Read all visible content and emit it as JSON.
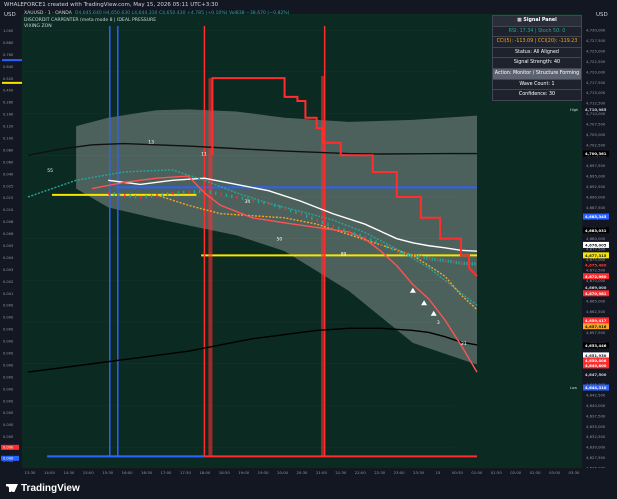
{
  "header": {
    "created_text": "WHALEFORCE1 created with TradingView.com, May 15, 2026 05:11 UTC+3:30",
    "symbol_line": "XAUUSD · 1 · OANDA",
    "ohlc": "O4,645.640 H4,650.630 L4,644.310 C4,650.430 +4.785 (+0.10%) Vol838 −38.670 (−0.82%)",
    "indicator_1": "DISCORDIT CARPENTER (meta mode 8 | IDEAL PRESSURE",
    "indicator_2": "VIXING ZON",
    "currency_left": "USD",
    "currency_right": "USD"
  },
  "signal_panel": {
    "title": "Signal Panel",
    "row_rsi": "RSI: 17.34 | Stoch 50: 0",
    "row_cci": "CCI(5): -113.09 | CCI(20): -119.23",
    "row_status": "Status: All Aligned",
    "row_strength": "Signal Strength: 40",
    "row_action": "Action: Monitor / Structure Forming",
    "row_wave": "Wave Count: 1",
    "row_confidence": "Confidence: 30",
    "colors": {
      "rsi_text": "#26a69a",
      "cci_text": "#f5a623",
      "action_bg": "#5d6270"
    }
  },
  "footer": {
    "brand": "TradingView"
  },
  "chart_data": {
    "type": "line",
    "x_ticks": [
      "13:30",
      "14:00",
      "14:30",
      "15:00",
      "15:30",
      "16:00",
      "16:30",
      "17:00",
      "17:30",
      "18:00",
      "18:30",
      "19:00",
      "19:30",
      "20:00",
      "20:30",
      "21:00",
      "21:30",
      "22:00",
      "22:30",
      "23:00",
      "23:30",
      "15",
      "00:30",
      "01:00",
      "01:30",
      "02:00",
      "02:30",
      "03:00",
      "03:30"
    ],
    "right_axis": {
      "ticks": [
        4730000,
        4727500,
        4725000,
        4722500,
        4720000,
        4717500,
        4715000,
        4712500,
        4710000,
        4707500,
        4705000,
        4702500,
        4700000,
        4697500,
        4695000,
        4692500,
        4690000,
        4687500,
        4685000,
        4682500,
        4680000,
        4677500,
        4675000,
        4672500,
        4670000,
        4667500,
        4665000,
        4662500,
        4660000,
        4657500,
        4655000,
        4652500,
        4650000,
        4647500,
        4645000,
        4642500,
        4640000,
        4637500,
        4635000,
        4632500,
        4630000,
        4627500,
        4625000
      ],
      "labels": [
        "4,730,000",
        "4,727,500",
        "4,725,000",
        "4,722,500",
        "4,720,000",
        "4,717,500",
        "4,715,000",
        "4,712,500",
        "4,710,000",
        "4,707,500",
        "4,705,000",
        "4,702,500",
        "4,700,000",
        "4,697,500",
        "4,695,000",
        "4,692,500",
        "4,690,000",
        "4,687,500",
        "4,685,000",
        "4,682,500",
        "4,680,000",
        "4,677,500",
        "4,675,000",
        "4,672,500",
        "4,670,000",
        "4,667,500",
        "4,665,000",
        "4,662,500",
        "4,660,000",
        "4,657,500",
        "4,655,000",
        "4,652,500",
        "4,650,000",
        "4,647,500",
        "4,645,000",
        "4,642,500",
        "4,640,000",
        "4,637,500",
        "4,635,000",
        "4,632,500",
        "4,630,000",
        "4,627,500",
        "4,625,000"
      ],
      "range": [
        4625000,
        4731000
      ]
    },
    "left_axis": {
      "labels": [
        "1.000",
        "0.880",
        "0.760",
        "0.640",
        "0.520",
        "0.400",
        "0.280",
        "0.160",
        "0.120",
        "0.100",
        "0.080",
        "0.060",
        "0.040",
        "0.025",
        "0.015",
        "0.010",
        "0.008",
        "0.006",
        "0.005",
        "0.004",
        "0.003",
        "0.002",
        "0.001",
        "0.000",
        "0.000",
        "0.000",
        "0.000",
        "0.000",
        "0.000",
        "0.000",
        "0.000",
        "0.000",
        "0.000",
        "0.000",
        "0.000",
        "0.000",
        "0.000"
      ]
    },
    "price_tags": [
      {
        "label": "High",
        "text": "4,710,985",
        "value": 4711000,
        "bg": "#131722",
        "fg": "#d1d4dc"
      },
      {
        "text": "4,700,361",
        "value": 4700400,
        "bg": "#000000",
        "fg": "#ffffff"
      },
      {
        "text": "4,685,345",
        "value": 4685300,
        "bg": "#2962ff",
        "fg": "#ffffff"
      },
      {
        "text": "4,683,031",
        "value": 4682000,
        "bg": "#000000",
        "fg": "#ffffff"
      },
      {
        "text": "4,676,005",
        "value": 4678500,
        "bg": "#ffffff",
        "fg": "#131722"
      },
      {
        "text": "4,677,315",
        "value": 4676000,
        "bg": "#f7e600",
        "fg": "#131722"
      },
      {
        "text": "4,675,480",
        "value": 4673700,
        "bg": "#131722",
        "fg": "#ff3b30"
      },
      {
        "text": "4,672,960",
        "value": 4671000,
        "bg": "#ff2d2d",
        "fg": "#ffffff"
      },
      {
        "text": "4,669,000",
        "value": 4668300,
        "bg": "#131722",
        "fg": "#d1d4dc"
      },
      {
        "text": "4,670,981",
        "value": 4666900,
        "bg": "#ff2d2d",
        "fg": "#ffffff"
      },
      {
        "text": "4,659,417",
        "value": 4660400,
        "bg": "#ff2d2d",
        "fg": "#ffffff"
      },
      {
        "text": "4,657,916",
        "value": 4659000,
        "bg": "#f5a623",
        "fg": "#131722"
      },
      {
        "text": "4,653,446",
        "value": 4654400,
        "bg": "#000000",
        "fg": "#ffffff"
      },
      {
        "text": "4,651,930",
        "value": 4652000,
        "bg": "#ffffff",
        "fg": "#131722"
      },
      {
        "text": "4,650,808",
        "value": 4650800,
        "bg": "#ff2d2d",
        "fg": "#ffffff"
      },
      {
        "text": "4,649,800",
        "value": 4649600,
        "bg": "#ff2d2d",
        "fg": "#ffffff"
      },
      {
        "text": "4,647,500",
        "value": 4647500,
        "bg": "#131722",
        "fg": "#d1d4dc"
      },
      {
        "label": "Low",
        "text": "4,644,310",
        "value": 4644300,
        "bg": "#2962ff",
        "fg": "#ffffff"
      }
    ],
    "left_tags": [
      {
        "text": "0.000",
        "color": "#ff2d2d"
      },
      {
        "text": "0.000",
        "color": "#2962ff"
      }
    ],
    "series": [
      {
        "type": "line",
        "color": "#111111",
        "x": [
          0,
          2,
          4,
          6,
          8,
          10,
          12,
          14,
          16,
          18,
          20,
          22,
          24,
          26,
          28
        ],
        "y": [
          4700000,
          4701500,
          4702500,
          4702800,
          4702500,
          4702200,
          4701800,
          4701400,
          4701000,
          4700700,
          4700400,
          4700300,
          4700350,
          4700400,
          4700400
        ]
      },
      {
        "type": "line",
        "color": "#ffffff",
        "x": [
          5,
          7,
          9,
          11,
          13,
          15,
          17,
          19,
          21,
          23,
          24,
          25,
          26,
          27,
          28
        ],
        "y": [
          4694000,
          4693000,
          4694000,
          4694500,
          4693000,
          4691500,
          4689000,
          4686000,
          4683500,
          4680000,
          4679000,
          4678300,
          4677800,
          4677200,
          4677000
        ]
      },
      {
        "type": "line",
        "color": "#000000",
        "x": [
          0,
          2,
          4,
          6,
          8,
          10,
          12,
          14,
          16,
          18,
          20,
          22,
          24,
          25,
          26,
          27,
          28
        ],
        "y": [
          4648000,
          4649000,
          4650000,
          4651000,
          4652000,
          4653000,
          4654500,
          4656000,
          4657000,
          4658000,
          4658500,
          4658500,
          4658000,
          4657500,
          4656500,
          4655200,
          4654500
        ]
      },
      {
        "type": "step",
        "color": "#ff2d2d",
        "x": [
          11.5,
          11.5,
          16,
          16,
          16.8,
          16.8,
          17.3,
          17.3,
          18,
          18,
          18.4,
          18.4,
          19.5,
          19.5,
          21.5,
          21.5,
          23,
          23,
          24.5,
          24.5,
          25.7,
          25.7,
          27,
          27,
          27.5,
          27.5,
          28
        ],
        "y": [
          4700000,
          4718500,
          4718500,
          4714000,
          4714000,
          4713000,
          4713000,
          4709000,
          4709000,
          4706500,
          4706500,
          4703000,
          4703000,
          4700000,
          4700000,
          4696000,
          4696000,
          4690000,
          4690000,
          4685000,
          4685000,
          4680000,
          4680000,
          4676000,
          4676000,
          4673000,
          4671000
        ]
      },
      {
        "type": "line",
        "color": "#26a69a",
        "dashed": true,
        "x": [
          0,
          3,
          6,
          9,
          11,
          13,
          15,
          17,
          19,
          21,
          23,
          25,
          27,
          28
        ],
        "y": [
          4690000,
          4694000,
          4696000,
          4696500,
          4694000,
          4691000,
          4688500,
          4686500,
          4684500,
          4681500,
          4677500,
          4673000,
          4667000,
          4664000
        ]
      },
      {
        "type": "line",
        "color": "#f5a623",
        "dashed": true,
        "x": [
          8,
          10,
          12,
          14,
          16,
          18,
          20,
          22,
          24,
          26,
          27,
          28
        ],
        "y": [
          4690500,
          4688000,
          4686000,
          4685500,
          4685000,
          4683500,
          4681000,
          4678500,
          4676000,
          4671000,
          4666500,
          4663000
        ]
      },
      {
        "type": "line",
        "color": "#ff5252",
        "x": [
          4,
          6,
          8,
          10,
          11,
          12,
          14,
          16,
          18,
          20,
          21,
          22,
          23,
          24,
          25,
          26,
          27,
          28
        ],
        "y": [
          4692000,
          4693500,
          4694500,
          4695000,
          4691000,
          4688000,
          4685000,
          4683800,
          4682700,
          4681600,
          4680000,
          4677000,
          4673500,
          4669000,
          4665500,
          4660500,
          4654500,
          4648000
        ]
      }
    ],
    "levels": [
      {
        "label": "yellow",
        "color": "#f7e600",
        "value": 4690500,
        "from": 1.5,
        "to": 10.5
      },
      {
        "label": "blue",
        "color": "#2962ff",
        "value": 4692300,
        "from": 5.4,
        "to": 28
      },
      {
        "label": "yellow",
        "color": "#f7e600",
        "value": 4676000,
        "from": 10.8,
        "to": 28
      },
      {
        "label": "red",
        "color": "#ff2d2d",
        "value": 4627800,
        "from": 1.2,
        "to": 28
      },
      {
        "label": "blue",
        "color": "#2962ff",
        "value": 4627800,
        "from": 1.2,
        "to": 11
      }
    ],
    "band": {
      "color": "#c8c8c8",
      "x": [
        3,
        5,
        8,
        10,
        13,
        16,
        20,
        24,
        28
      ],
      "upper": [
        4707000,
        4709000,
        4710800,
        4711000,
        4710500,
        4709000,
        4708000,
        4708500,
        4709500
      ],
      "lower": [
        4692000,
        4687500,
        4684800,
        4683200,
        4680800,
        4677000,
        4667500,
        4655000,
        4649800
      ]
    },
    "annotations": [
      {
        "text": "13",
        "x": 7.5,
        "y": 4702800
      },
      {
        "text": "11",
        "x": 10.8,
        "y": 4700000
      },
      {
        "text": "34",
        "x": 13.5,
        "y": 4688500
      },
      {
        "text": "50",
        "x": 15.5,
        "y": 4679500
      },
      {
        "text": "89",
        "x": 19.5,
        "y": 4676000
      },
      {
        "text": "3",
        "x": 25.5,
        "y": 4659500
      },
      {
        "text": "21",
        "x": 27,
        "y": 4654500
      },
      {
        "text": "55",
        "x": 1.2,
        "y": 4696000
      }
    ],
    "x_range": [
      0,
      28
    ]
  }
}
